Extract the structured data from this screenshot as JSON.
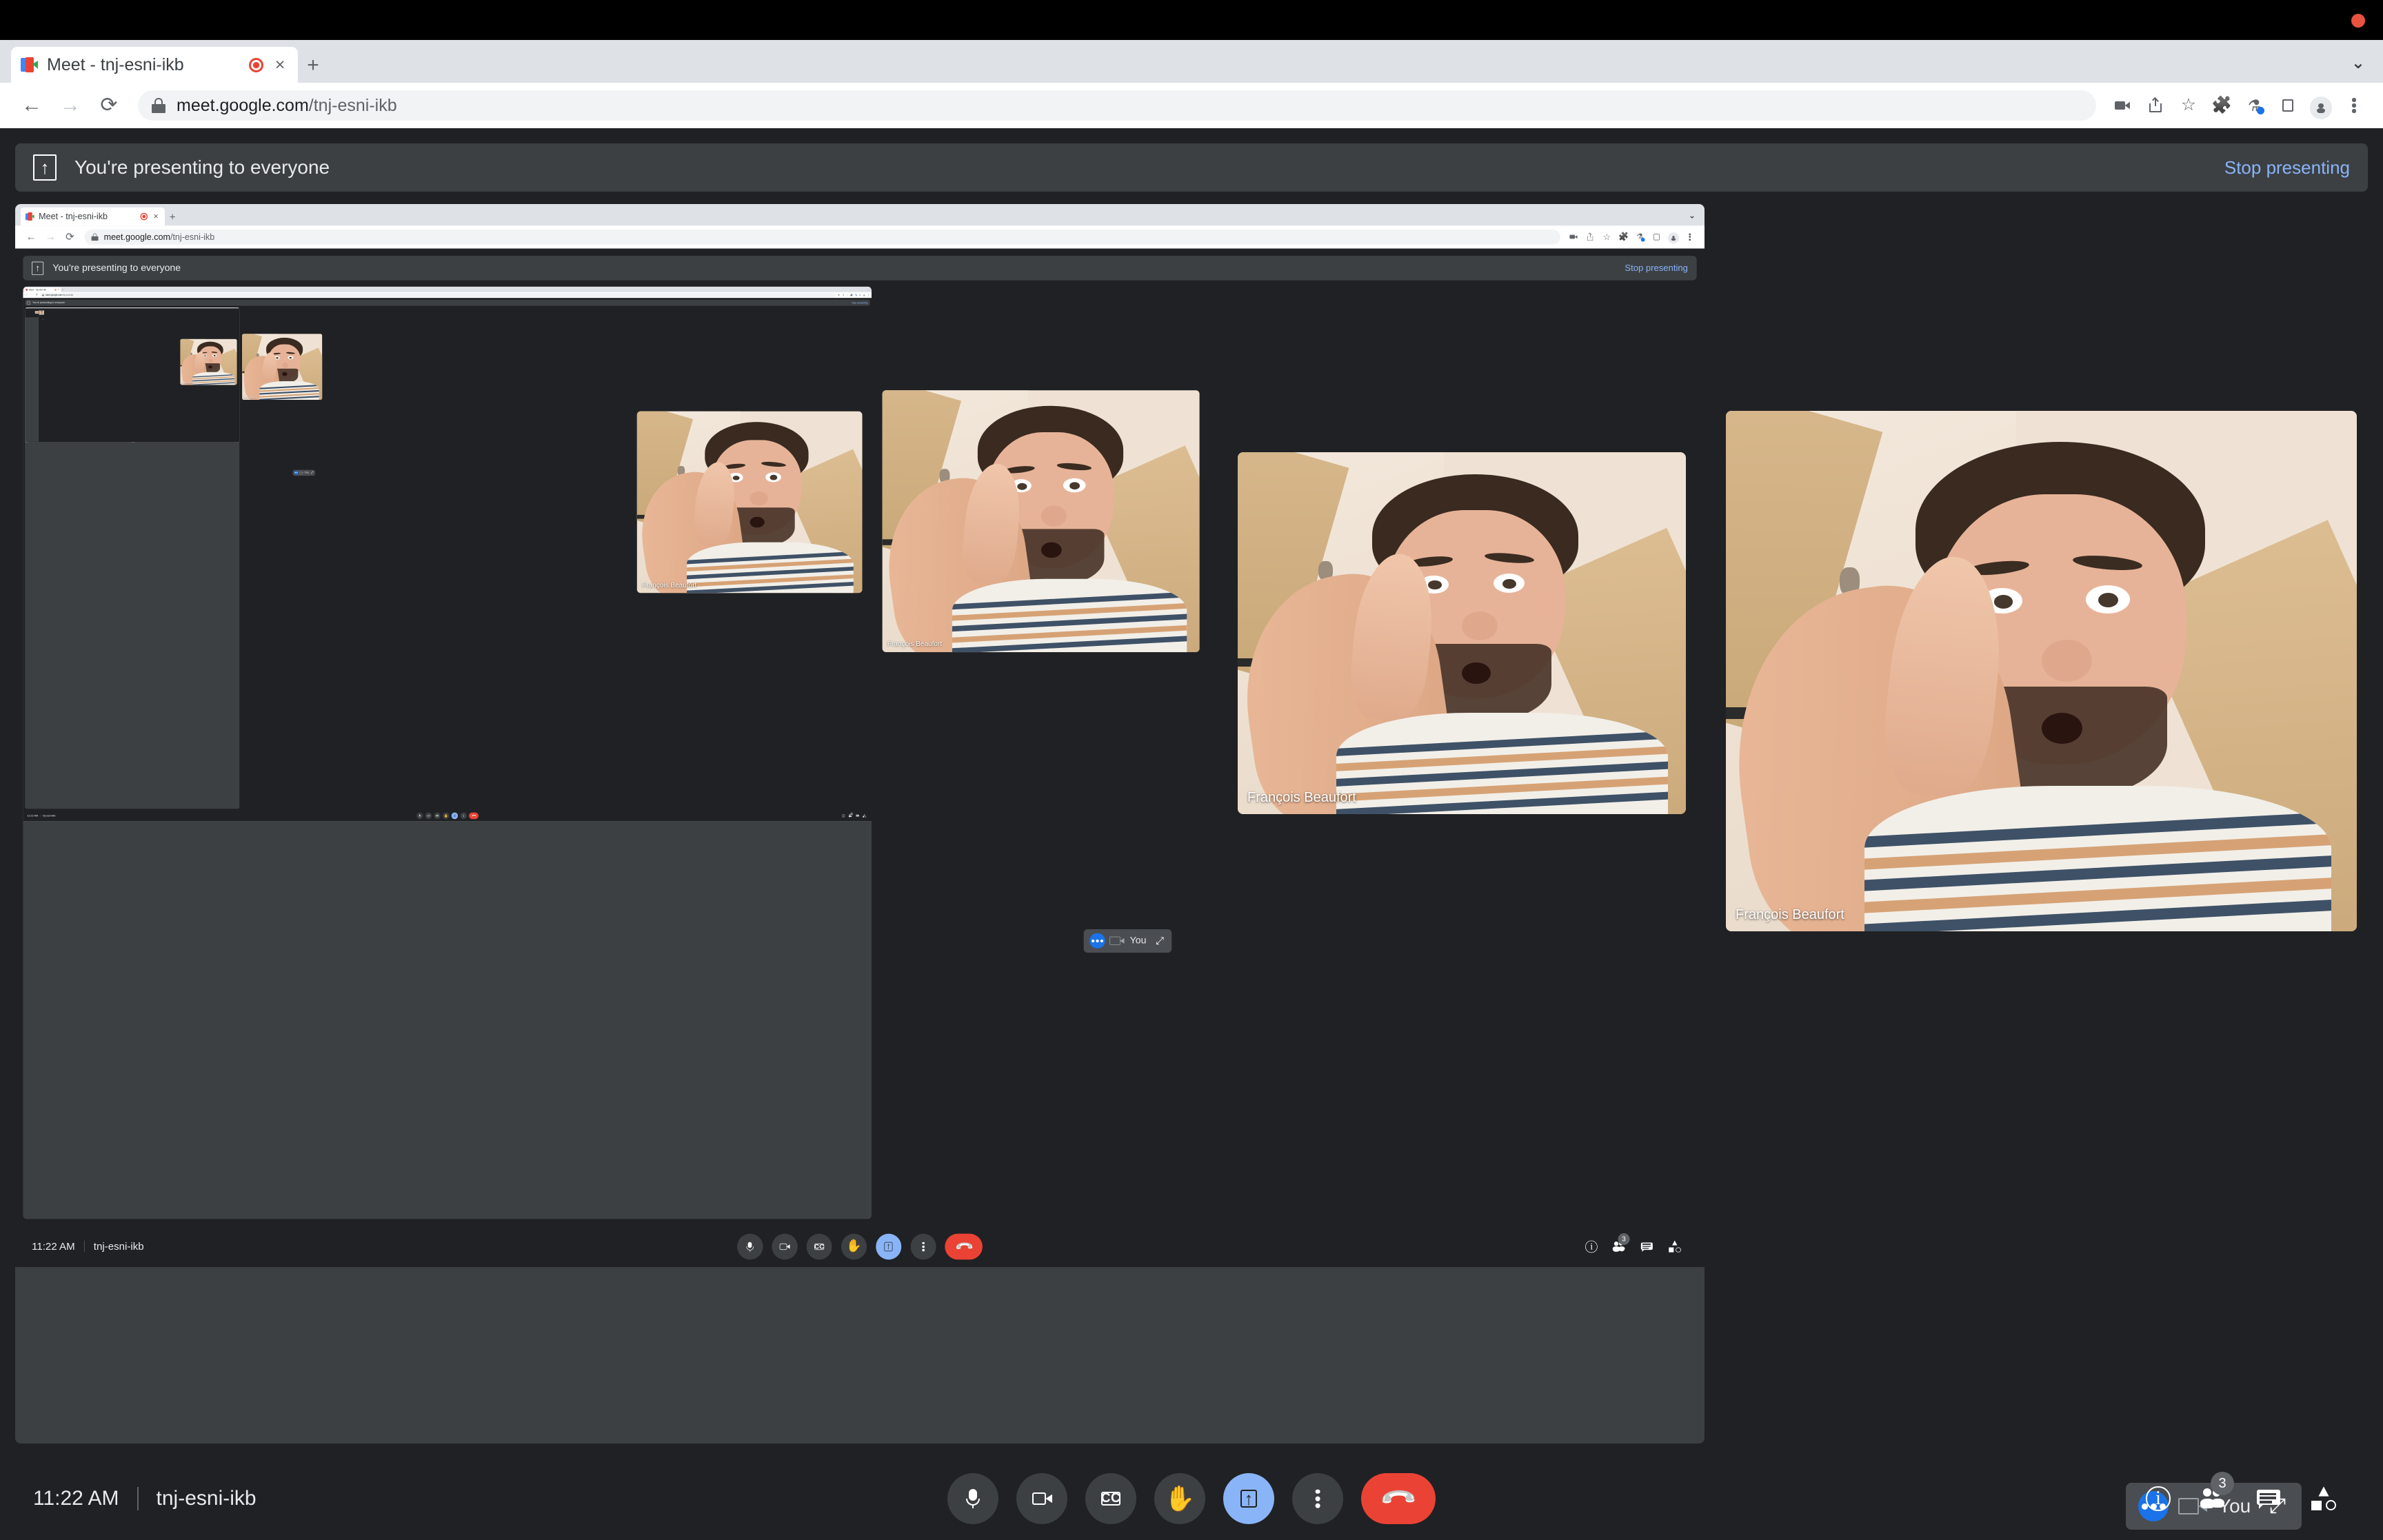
{
  "window": {
    "os_titlebar_color": "#000000",
    "recording_indicator": "recording-dot",
    "recording_color": "#e8533f"
  },
  "browser": {
    "tab": {
      "title": "Meet - tnj-esni-ikb",
      "favicon": "google-meet-favicon",
      "recording_icon": "tab-recording-icon",
      "close_icon": "×",
      "new_tab_icon": "+"
    },
    "tabstrip_chevron": "⌄",
    "nav": {
      "back_icon": "←",
      "forward_icon": "→",
      "reload_icon": "⟳"
    },
    "address": {
      "lock_icon": "site-lock-icon",
      "url_host": "meet.google.com",
      "url_path": "/tnj-esni-ikb",
      "url_full": "meet.google.com/tnj-esni-ikb"
    },
    "toolbar_icons": [
      "video-camera-icon",
      "share-icon",
      "bookmark-star-icon",
      "extensions-puzzle-icon",
      "labs-flask-icon",
      "side-panel-icon",
      "profile-avatar-icon",
      "chrome-menu-kebab-icon"
    ],
    "colors": {
      "tabstrip_bg": "#dee1e6",
      "toolbar_bg": "#ffffff",
      "omnibox_bg": "#f1f3f4",
      "tab_active_bg": "#ffffff"
    }
  },
  "meet": {
    "banner": {
      "present_icon": "present-to-everyone-icon",
      "text": "You're presenting to everyone",
      "stop_label": "Stop presenting",
      "stop_color": "#8ab4f8",
      "bg_color": "#3c4043"
    },
    "stage": {
      "label": "shared-screen-stage",
      "bg_color": "#3c4043"
    },
    "participant": {
      "name": "François Beaufort",
      "tiles": 2
    },
    "you_pill": {
      "dots_icon": "speaking-dots-icon",
      "camera_icon": "camera-off-icon",
      "label": "You",
      "expand_icon": "⤢"
    },
    "bottom_bar": {
      "time": "11:22 AM",
      "meeting_code": "tnj-esni-ikb",
      "controls": [
        {
          "name": "microphone-button",
          "icon": "mic-icon",
          "state": "on"
        },
        {
          "name": "camera-button",
          "icon": "camera-icon",
          "state": "on"
        },
        {
          "name": "captions-button",
          "icon": "cc-icon",
          "label": "CC",
          "state": "off"
        },
        {
          "name": "raise-hand-button",
          "icon": "hand-icon",
          "state": "off"
        },
        {
          "name": "present-now-button",
          "icon": "present-screen-icon",
          "state": "active"
        },
        {
          "name": "more-options-button",
          "icon": "kebab-icon",
          "state": "off"
        },
        {
          "name": "leave-call-button",
          "icon": "phone-hangup-icon",
          "state": "danger"
        }
      ],
      "right_controls": [
        {
          "name": "meeting-details-button",
          "icon": "info-icon"
        },
        {
          "name": "participants-button",
          "icon": "people-icon",
          "badge": "3"
        },
        {
          "name": "chat-button",
          "icon": "chat-icon"
        },
        {
          "name": "activities-button",
          "icon": "activities-shapes-icon"
        }
      ],
      "accent_active": "#8ab4f8",
      "accent_danger": "#ea4335",
      "control_bg": "#3c4043",
      "bar_bg": "#202124"
    }
  }
}
